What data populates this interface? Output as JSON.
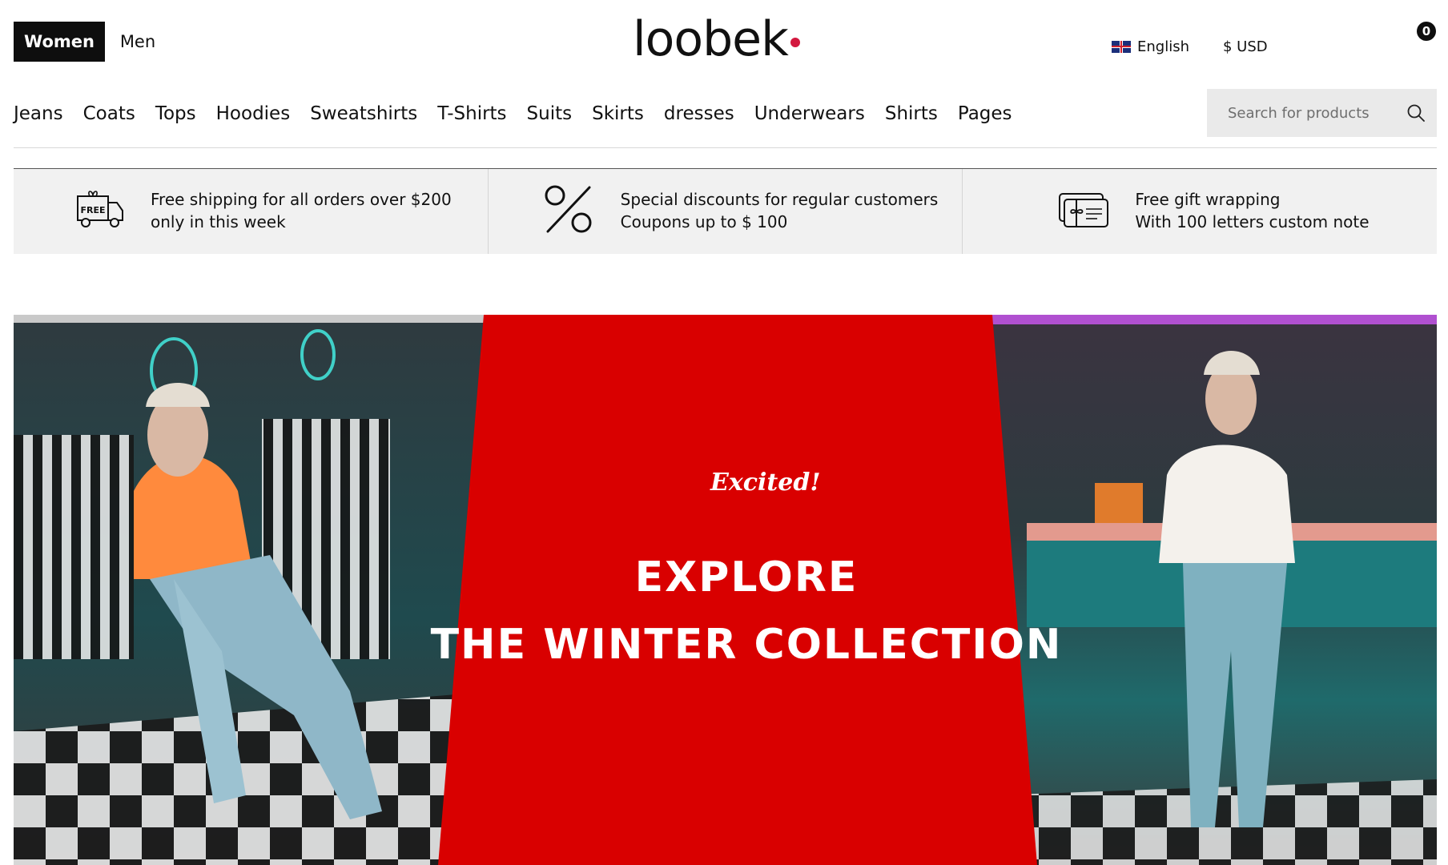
{
  "header": {
    "gender_tabs": [
      {
        "label": "Women",
        "active": true
      },
      {
        "label": "Men",
        "active": false
      }
    ],
    "logo_text": "loobek",
    "language": "English",
    "currency": "$ USD",
    "cart_count": "0",
    "accent_color": "#d3183f"
  },
  "nav": {
    "items": [
      "Jeans",
      "Coats",
      "Tops",
      "Hoodies",
      "Sweatshirts",
      "T-Shirts",
      "Suits",
      "Skirts",
      "dresses",
      "Underwears",
      "Shirts",
      "Pages"
    ]
  },
  "search": {
    "placeholder": "Search for products",
    "icon": "search-icon"
  },
  "features": [
    {
      "icon": "free-delivery-truck-icon",
      "line1": "Free shipping for all orders over $200",
      "line2": "only in this week"
    },
    {
      "icon": "percent-icon",
      "line1": "Special discounts for regular customers",
      "line2": "Coupons up to $ 100"
    },
    {
      "icon": "gift-card-icon",
      "line1": "Free gift wrapping",
      "line2": "With 100 letters custom note"
    }
  ],
  "hero": {
    "tagline": "Excited!",
    "headline_line1": "EXPLORE",
    "headline_line2": "THE WINTER COLLECTION",
    "panel_color": "#d90000",
    "truck_icon_text": "FREE"
  }
}
